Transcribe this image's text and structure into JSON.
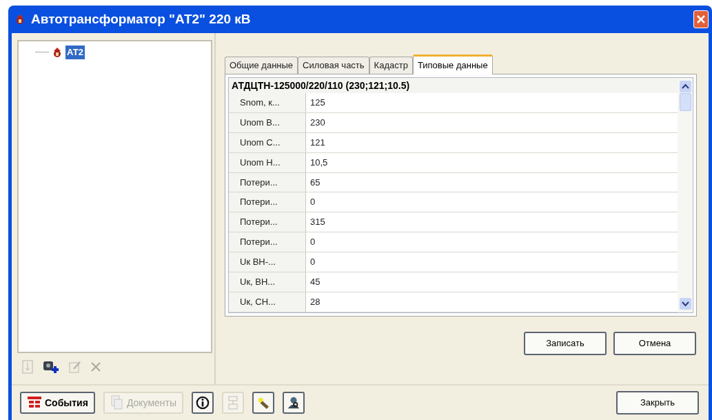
{
  "window": {
    "title": "Автотрансформатор \"АТ2\" 220 кВ"
  },
  "tree": {
    "items": [
      {
        "label": "АТ2",
        "selected": true
      }
    ]
  },
  "tree_toolbar": [
    {
      "kind": "refresh",
      "disabled": true
    },
    {
      "kind": "add",
      "disabled": false
    },
    {
      "kind": "edit",
      "disabled": true
    },
    {
      "kind": "delete",
      "disabled": true
    }
  ],
  "tabs": [
    {
      "label": "Общие данные",
      "selected": false
    },
    {
      "label": "Силовая часть",
      "selected": false
    },
    {
      "label": "Кадастр",
      "selected": false
    },
    {
      "label": "Типовые данные",
      "selected": true
    }
  ],
  "grid": {
    "title": "АТДЦТН-125000/220/110 (230;121;10.5)",
    "rows": [
      {
        "name": "Snom, к...",
        "value": "125"
      },
      {
        "name": "Unom В...",
        "value": "230"
      },
      {
        "name": "Unom С...",
        "value": "121"
      },
      {
        "name": "Unom Н...",
        "value": "10,5"
      },
      {
        "name": "Потери...",
        "value": "65"
      },
      {
        "name": "Потери...",
        "value": "0"
      },
      {
        "name": "Потери...",
        "value": "315"
      },
      {
        "name": "Потери...",
        "value": "0"
      },
      {
        "name": "Uк ВН-...",
        "value": "0"
      },
      {
        "name": "Uк, ВН...",
        "value": "45"
      },
      {
        "name": "Uк, СН...",
        "value": "28"
      }
    ]
  },
  "form_buttons": [
    "Записать",
    "Отмена"
  ],
  "bottom_bar": [
    {
      "kind": "events",
      "label": "События",
      "disabled": false
    },
    {
      "kind": "documents",
      "label": "Документы",
      "disabled": true
    },
    {
      "kind": "info",
      "disabled": false
    },
    {
      "kind": "scheme",
      "disabled": true
    },
    {
      "kind": "tool",
      "disabled": false
    },
    {
      "kind": "user",
      "disabled": false
    }
  ],
  "close_button": "Закрыть"
}
